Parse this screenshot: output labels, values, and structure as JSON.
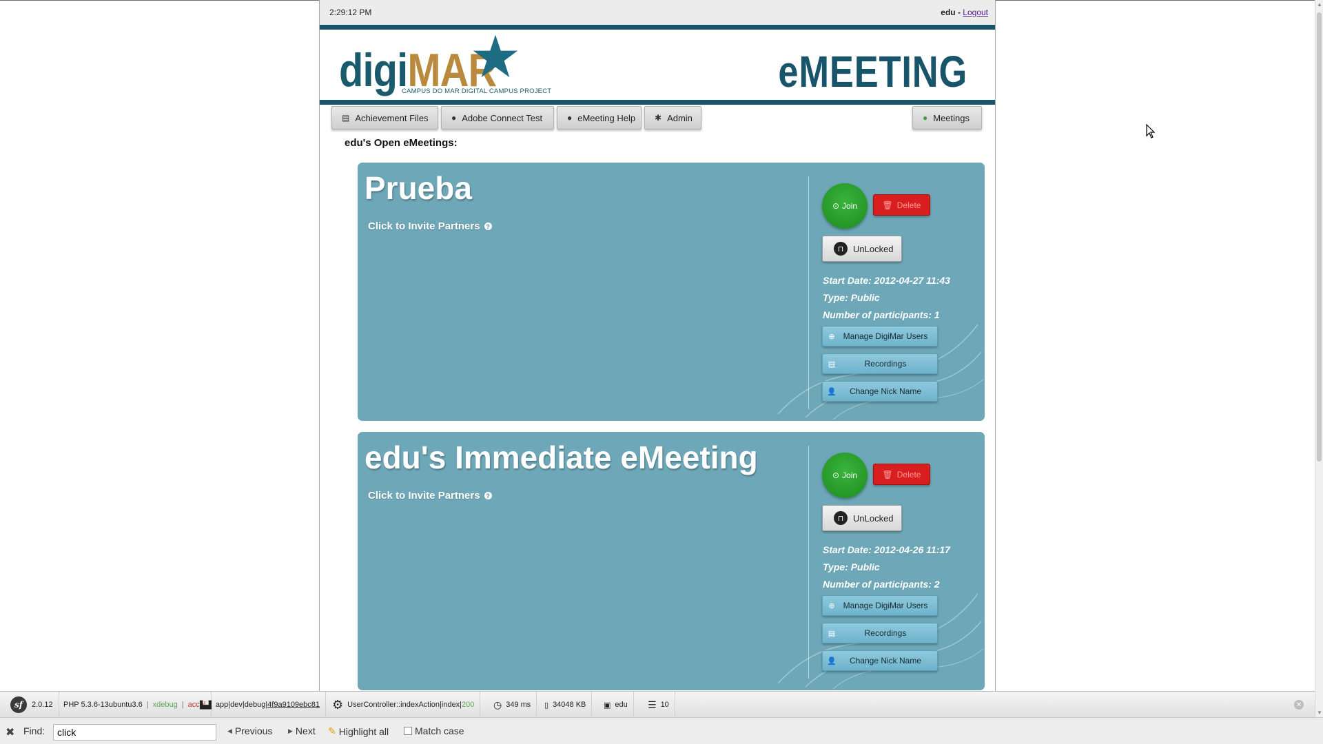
{
  "topbar": {
    "time": "2:29:12 PM",
    "username": "edu",
    "separator": " - ",
    "logout": "Logout"
  },
  "header": {
    "logo_digi": "digi",
    "logo_mar": "MAR",
    "logo_tagline": "CAMPUS DO MAR DIGITAL CAMPUS PROJECT",
    "app_title": "eMEETING"
  },
  "nav": {
    "achievement": "Achievement Files",
    "adobe": "Adobe Connect Test",
    "help": "eMeeting Help",
    "admin": "Admin",
    "meetings": "Meetings"
  },
  "section_title": "edu's Open eMeetings:",
  "meetings": [
    {
      "title": "Prueba",
      "invite": "Click to Invite Partners",
      "join": "Join",
      "delete": "Delete",
      "lock": "UnLocked",
      "start_date": "Start Date: 2012-04-27 11:43",
      "type": "Type: Public",
      "participants": "Number of participants: 1",
      "manage": "Manage DigiMar Users",
      "recordings": "Recordings",
      "nickname": "Change Nick Name"
    },
    {
      "title": "edu's Immediate eMeeting",
      "invite": "Click to Invite Partners",
      "join": "Join",
      "delete": "Delete",
      "lock": "UnLocked",
      "start_date": "Start Date: 2012-04-26 11:17",
      "type": "Type: Public",
      "participants": "Number of participants: 2",
      "manage": "Manage DigiMar Users",
      "recordings": "Recordings",
      "nickname": "Change Nick Name"
    }
  ],
  "debug_toolbar": {
    "sf_version": "2.0.12",
    "php_version": "PHP 5.3.6-13ubuntu3.6",
    "php_sep1": "|",
    "php_xdebug": "xdebug",
    "php_sep2": "|",
    "php_accel": "accel",
    "env": "app|dev|debug|",
    "token": "4f9a9109ebc81",
    "controller": "UserController::indexAction|index|",
    "status": "200",
    "time": "349 ms",
    "memory": "34048 KB",
    "user": "edu",
    "queries": "10"
  },
  "findbar": {
    "label": "Find:",
    "query": "click",
    "previous": "Previous",
    "next": "Next",
    "highlight": "Highlight all",
    "match_case": "Match case"
  }
}
